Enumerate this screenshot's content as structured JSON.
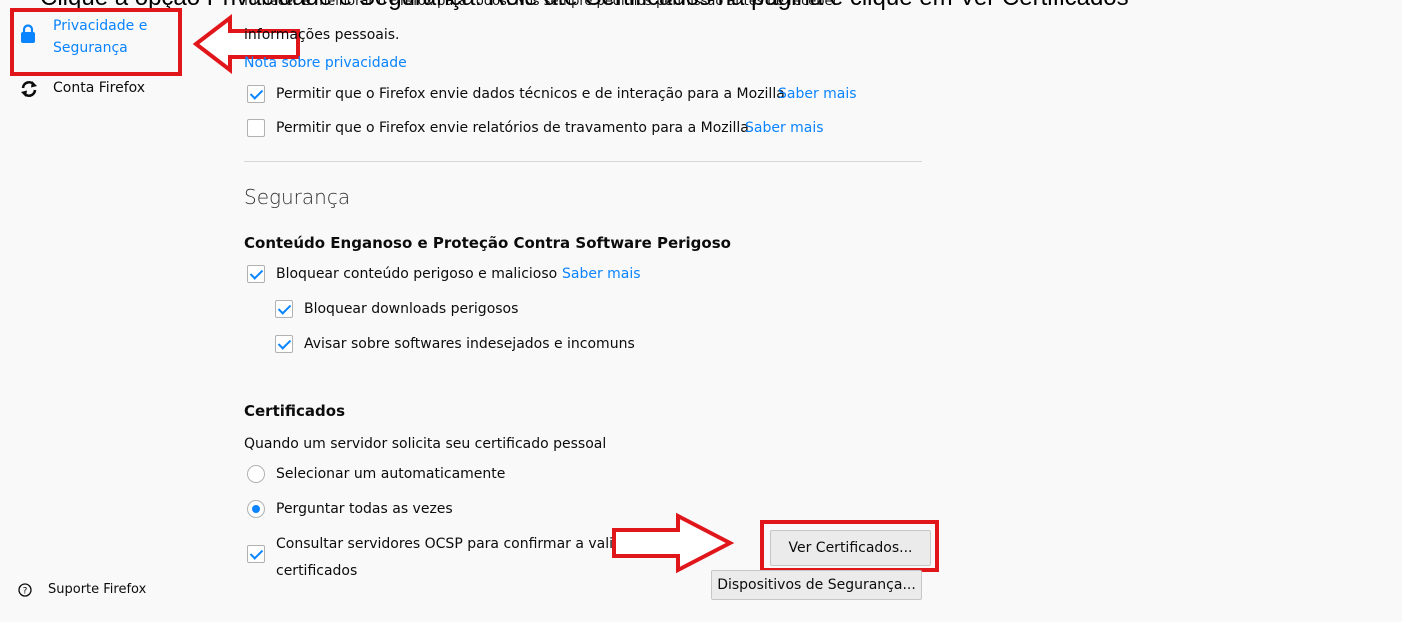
{
  "caption": {
    "text": "Clique a opção Privacidade e Segurança. Role até Certificados na página e clique em Ver Certificados"
  },
  "sidebar": {
    "privacy": {
      "line1": "Privacidade e",
      "line2": "Segurança"
    },
    "account": {
      "label": "Conta Firefox"
    },
    "support": {
      "label": "Suporte Firefox"
    }
  },
  "data_collection": {
    "cut_text": "fornecer e melhorar o Firefox para todos. Nós sempre pedimos permissão antes de receber",
    "info_text": "informações pessoais.",
    "privacy_link": "Nota sobre privacidade",
    "technical_label": "Permitir que o Firefox envie dados técnicos e de interação para a Mozilla",
    "technical_link": "Saber mais",
    "technical_checked": true,
    "crash_label": "Permitir que o Firefox envie relatórios de travamento para a Mozilla",
    "crash_link": "Saber mais",
    "crash_checked": false
  },
  "security": {
    "title": "Segurança",
    "deceptive_heading": "Conteúdo Enganoso e Proteção Contra Software Perigoso",
    "block_dangerous": {
      "label": "Bloquear conteúdo perigoso e malicioso",
      "link": "Saber mais",
      "checked": true
    },
    "block_downloads": {
      "label": "Bloquear downloads perigosos",
      "checked": true
    },
    "warn_unwanted": {
      "label": "Avisar sobre softwares indesejados e incomuns",
      "checked": true
    }
  },
  "certificates": {
    "heading": "Certificados",
    "question": "Quando um servidor solicita seu certificado pessoal",
    "auto_select": {
      "label": "Selecionar um automaticamente",
      "checked": false
    },
    "ask_every_time": {
      "label": "Perguntar todas as vezes",
      "checked": true
    },
    "ocsp": {
      "line1": "Consultar servidores OCSP para confirmar a validade atual dos",
      "line2": "certificados",
      "checked": true
    },
    "view_button": "Ver Certificados...",
    "devices_button": "Dispositivos de Segurança..."
  },
  "colors": {
    "accent": "#0a84ff",
    "annotation_red": "#e1161b",
    "background": "#f9f9fa"
  },
  "icons": {
    "privacy": "lock-icon",
    "account": "sync-icon",
    "support": "help-icon"
  }
}
